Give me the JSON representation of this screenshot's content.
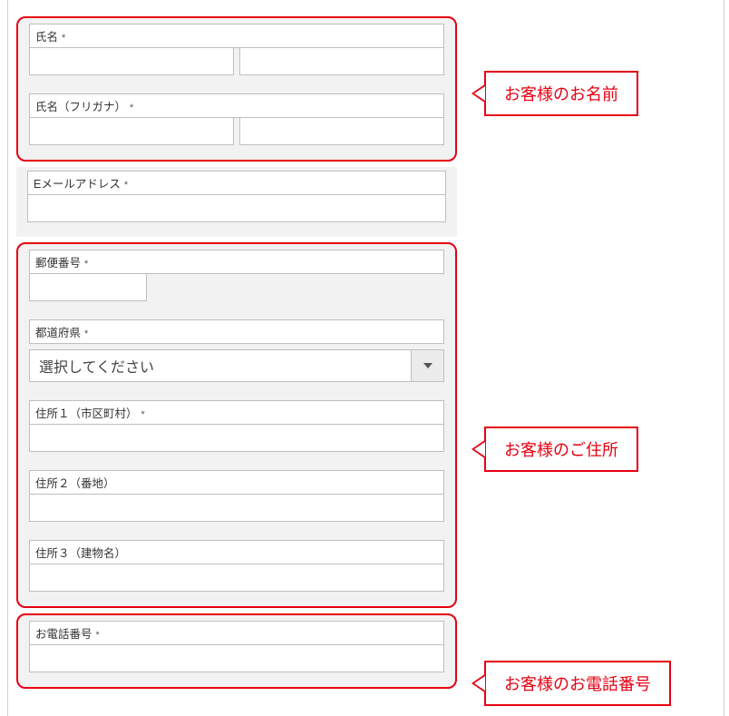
{
  "fields": {
    "name": {
      "label": "氏名",
      "required": true
    },
    "name_kana": {
      "label": "氏名（フリガナ）",
      "required": true
    },
    "email": {
      "label": "Eメールアドレス",
      "required": true
    },
    "postal": {
      "label": "郵便番号",
      "required": true
    },
    "pref": {
      "label": "都道府県",
      "required": true,
      "selected": "選択してください"
    },
    "addr1": {
      "label": "住所１（市区町村）",
      "required": true
    },
    "addr2": {
      "label": "住所２（番地）",
      "required": false
    },
    "addr3": {
      "label": "住所３（建物名）",
      "required": false
    },
    "phone": {
      "label": "お電話番号",
      "required": true
    }
  },
  "required_mark": "*",
  "callouts": {
    "name": "お客様のお名前",
    "address": "お客様のご住所",
    "phone": "お客様のお電話番号"
  }
}
